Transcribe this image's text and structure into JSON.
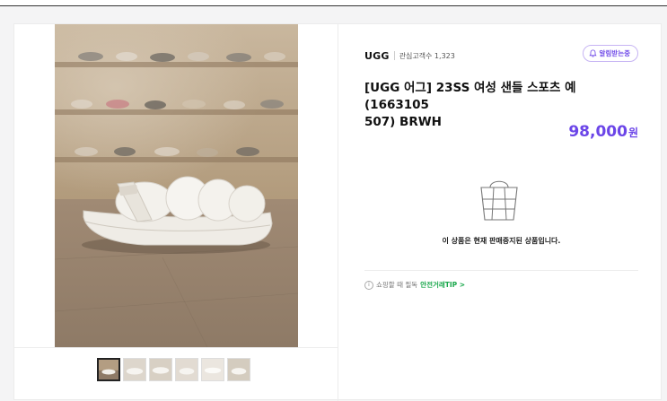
{
  "product": {
    "brand": "UGG",
    "watchers_label": "관심고객수 1,323",
    "notify_label": "알림받는중",
    "title_line1": "[UGG 어그] 23SS 여성 샌들 스포츠 예 (1663105",
    "title_line2": "507) BRWH",
    "price": "98,000",
    "price_unit": "원",
    "soldout_message": "이 상품은 현재 판매중지된 상품입니다.",
    "tip_prefix": "쇼핑할 때 필독",
    "tip_link": "안전거래TIP >"
  },
  "gallery": {
    "thumbnail_count": 6,
    "selected_thumbnail": 1
  },
  "colors": {
    "accent_purple": "#6b45e8",
    "tip_green": "#19a74b"
  }
}
